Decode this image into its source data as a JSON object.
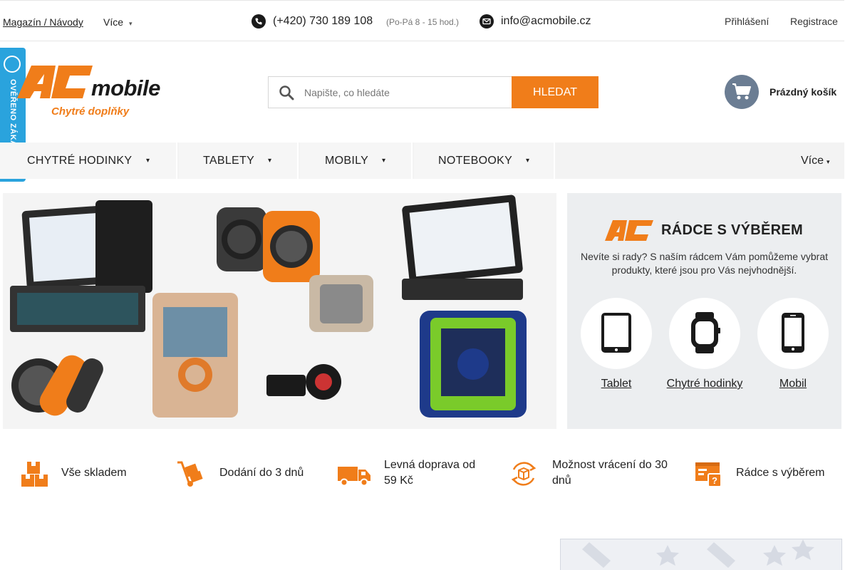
{
  "topbar": {
    "magazin": "Magazín / Návody",
    "more": "Více",
    "phone": "(+420) 730 189 108",
    "hours": "(Po-Pá 8 - 15 hod.)",
    "email": "info@acmobile.cz",
    "login": "Přihlášení",
    "register": "Registrace"
  },
  "verified_badge": {
    "text": "OVĚŘENO ZÁKAZNÍKY",
    "seal_text": "OVĚŘENO ZÁKAZNÍKY"
  },
  "logo": {
    "brand_letters": "AC",
    "brand_word": "mobile",
    "tagline": "Chytré doplňky"
  },
  "search": {
    "placeholder": "Napište, co hledáte",
    "button": "HLEDAT"
  },
  "cart": {
    "label": "Prázdný košík"
  },
  "nav": {
    "items": [
      {
        "label": "CHYTRÉ HODINKY"
      },
      {
        "label": "TABLETY"
      },
      {
        "label": "MOBILY"
      },
      {
        "label": "NOTEBOOKY"
      }
    ],
    "more": "Více"
  },
  "advisor": {
    "title": "RÁDCE S VÝBĚREM",
    "description": "Nevíte si rady? S naším rádcem Vám pomůžeme vybrat produkty, které jsou pro Vás nejvhodnější.",
    "options": [
      {
        "label": "Tablet",
        "icon": "tablet-icon"
      },
      {
        "label": "Chytré hodinky",
        "icon": "smartwatch-icon"
      },
      {
        "label": "Mobil",
        "icon": "mobile-icon"
      }
    ]
  },
  "features": [
    {
      "label": "Vše skladem",
      "icon": "boxes-icon"
    },
    {
      "label": "Dodání do 3 dnů",
      "icon": "hand-truck-icon"
    },
    {
      "label": "Levná doprava od 59 Kč",
      "icon": "delivery-truck-icon"
    },
    {
      "label": "Možnost vrácení do 30 dnů",
      "icon": "return-box-icon"
    },
    {
      "label": "Rádce s výběrem",
      "icon": "advisor-icon"
    }
  ],
  "colors": {
    "accent": "#f07d1a",
    "badge_blue": "#2aa3dd",
    "cart_gray": "#6b7d93",
    "nav_bg": "#f3f3f3"
  }
}
